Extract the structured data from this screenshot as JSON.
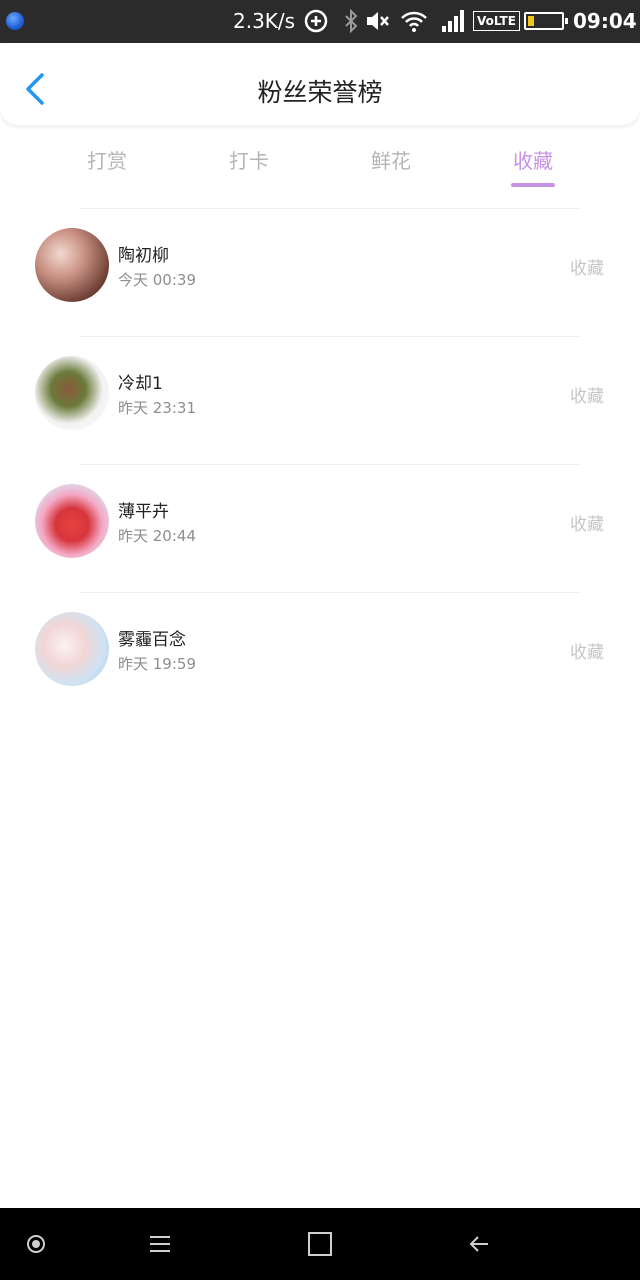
{
  "status_bar": {
    "net_speed": "2.3K/s",
    "network_type": "VoLTE",
    "time": "09:04",
    "battery_level": 0.2,
    "icons": [
      "app-dot-icon",
      "data-saver-icon",
      "bluetooth-icon",
      "mute-icon",
      "wifi-icon",
      "signal-icon",
      "battery-icon"
    ]
  },
  "header": {
    "title": "粉丝荣誉榜",
    "back_icon": "chevron-left-icon"
  },
  "tabs": [
    {
      "label": "打赏",
      "active": false
    },
    {
      "label": "打卡",
      "active": false
    },
    {
      "label": "鲜花",
      "active": false
    },
    {
      "label": "收藏",
      "active": true
    }
  ],
  "list": [
    {
      "name": "陶初柳",
      "time": "今天 00:39",
      "action": "收藏"
    },
    {
      "name": "冷却1",
      "time": "昨天 23:31",
      "action": "收藏"
    },
    {
      "name": "薄平卉",
      "time": "昨天 20:44",
      "action": "收藏"
    },
    {
      "name": "雾霾百念",
      "time": "昨天 19:59",
      "action": "收藏"
    }
  ],
  "nav_bar": {
    "icons": [
      "circle-icon",
      "menu-icon",
      "square-icon",
      "back-arrow-icon"
    ]
  },
  "colors": {
    "accent": "#c893e6",
    "back_icon": "#2196f3",
    "inactive_tab": "#b5b5b5"
  }
}
